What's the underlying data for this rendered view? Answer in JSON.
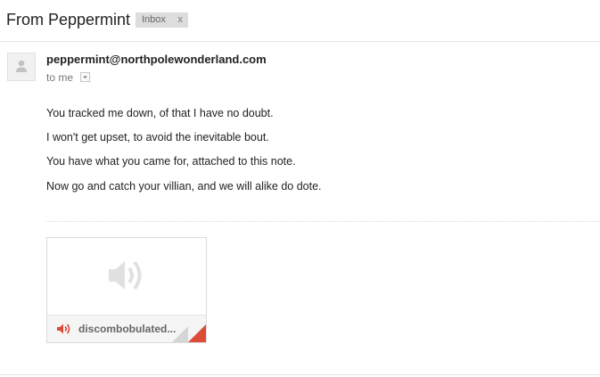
{
  "subject": {
    "title": "From Peppermint",
    "label": "Inbox",
    "label_remove": "x"
  },
  "message": {
    "sender": "peppermint@northpolewonderland.com",
    "recipient": "to me",
    "body": [
      "You tracked me down, of that I have no doubt.",
      "I won't get upset, to avoid the inevitable bout.",
      "You have what you came for, attached to this note.",
      "Now go and catch your villian, and we will alike do dote."
    ]
  },
  "attachment": {
    "name": "discombobulated...",
    "icon": "audio-speaker-icon",
    "badge_color": "#dd4b39"
  }
}
